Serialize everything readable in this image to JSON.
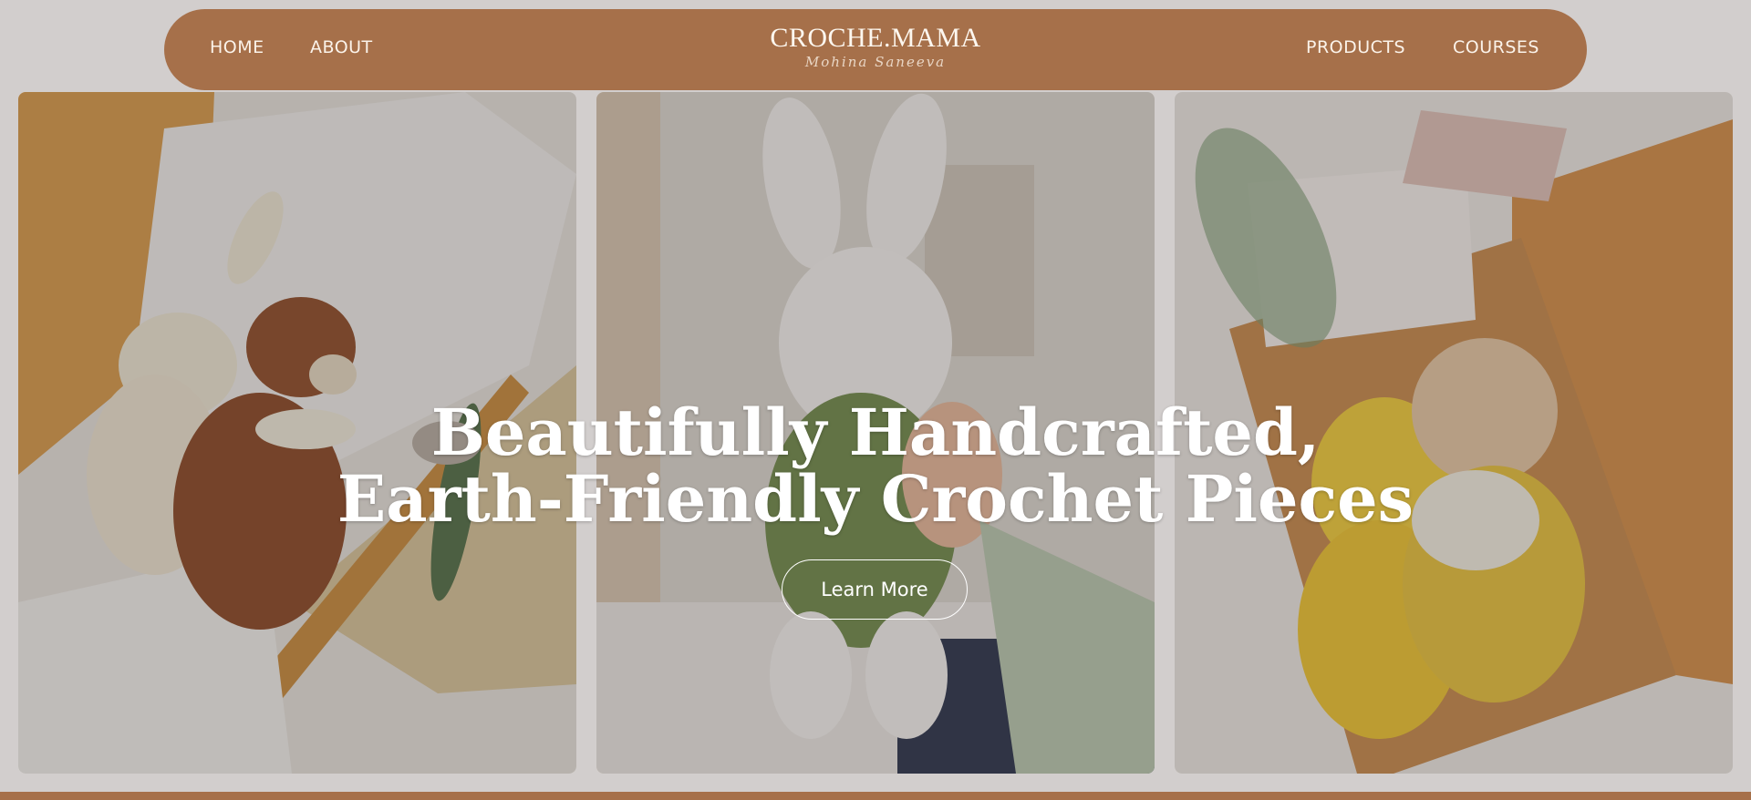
{
  "nav": {
    "left_links": [
      "HOME",
      "ABOUT"
    ],
    "right_links": [
      "PRODUCTS",
      "COURSES"
    ],
    "brand": {
      "name": "CROCHE.MAMA",
      "script": "Mohina Saneeva"
    },
    "color": "#a6704a"
  },
  "hero": {
    "line1": "Beautifully Handcrafted,",
    "line2": "Earth-Friendly Crochet Pieces",
    "button": "Learn More"
  },
  "images": [
    "crochet-bunny-and-bear-in-box",
    "crochet-bunny-in-green-overalls",
    "crochet-giraffe-and-bunny-in-box"
  ],
  "colors": {
    "brand": "#a6704a",
    "text": "#ffffff",
    "page_bg": "#d2cecd"
  }
}
